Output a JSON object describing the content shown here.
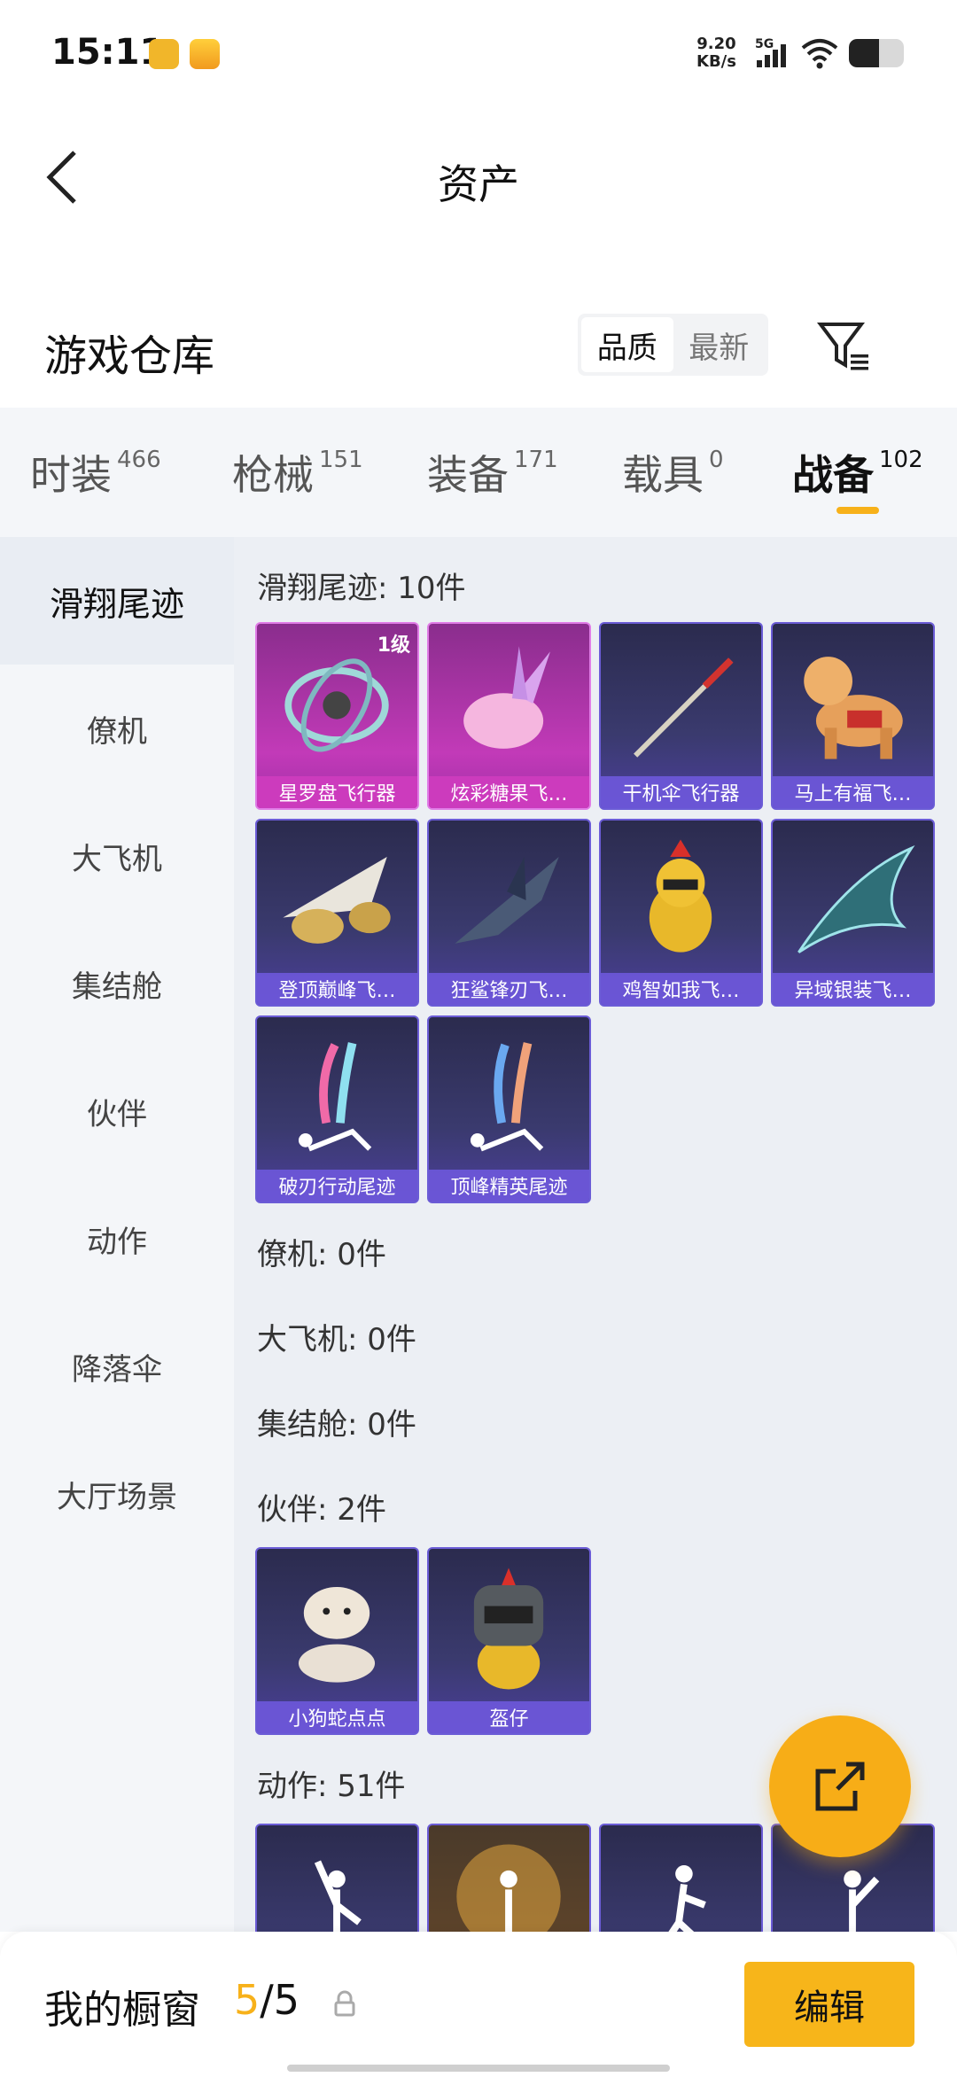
{
  "status_bar": {
    "time": "15:11",
    "net_speed_value": "9.20",
    "net_speed_unit": "KB/s",
    "network": "5G",
    "battery_level": 0.55
  },
  "nav": {
    "title": "资产"
  },
  "warehouse": {
    "title": "游戏仓库",
    "sort_options": [
      "品质",
      "最新"
    ],
    "sort_selected": "品质"
  },
  "tabs": [
    {
      "label": "时装",
      "count": "466"
    },
    {
      "label": "枪械",
      "count": "151"
    },
    {
      "label": "装备",
      "count": "171"
    },
    {
      "label": "载具",
      "count": "0"
    },
    {
      "label": "战备",
      "count": "102"
    }
  ],
  "sidebar": [
    "滑翔尾迹",
    "僚机",
    "大飞机",
    "集结舱",
    "伙伴",
    "动作",
    "降落伞",
    "大厅场景"
  ],
  "sections": {
    "glide": {
      "title": "滑翔尾迹: 10件",
      "items": [
        "星罗盘飞行器",
        "炫彩糖果飞…",
        "干机伞飞行器",
        "马上有福飞…",
        "登顶巅峰飞…",
        "狂鲨锋刃飞…",
        "鸡智如我飞…",
        "异域银装飞…",
        "破刃行动尾迹",
        "顶峰精英尾迹"
      ],
      "first_level": "1级"
    },
    "wingman": {
      "title": "僚机: 0件"
    },
    "plane": {
      "title": "大飞机: 0件"
    },
    "pod": {
      "title": "集结舱: 0件"
    },
    "partner": {
      "title": "伙伴: 2件",
      "items": [
        "小狗蛇点点",
        "盔仔"
      ]
    },
    "emote": {
      "title": "动作: 51件"
    }
  },
  "bottom": {
    "showcase_label": "我的橱窗",
    "showcase_current": "5",
    "showcase_total": "/5",
    "edit_label": "编辑"
  },
  "colors": {
    "accent": "#f7b11a",
    "card_purple": "#6b5cd6",
    "card_pink": "#c23ab8"
  }
}
